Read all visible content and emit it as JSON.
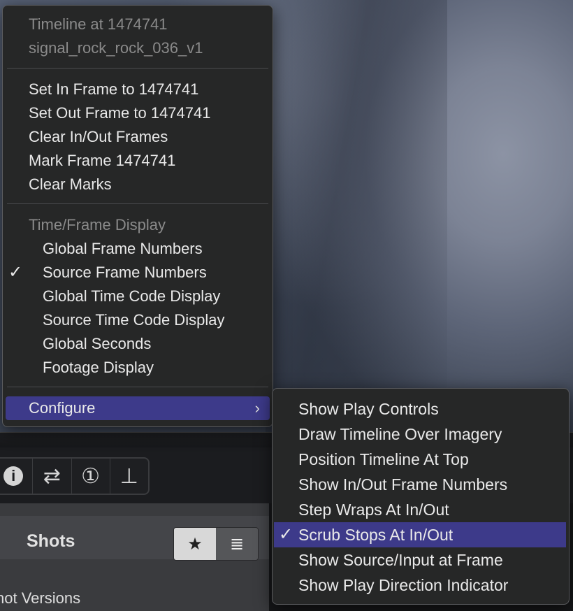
{
  "menu": {
    "header": {
      "line1": "Timeline at 1474741",
      "line2": "signal_rock_rock_036_v1"
    },
    "frame_items": [
      "Set In Frame to 1474741",
      "Set Out Frame to 1474741",
      "Clear In/Out Frames",
      "Mark Frame 1474741",
      "Clear Marks"
    ],
    "display_section": {
      "label": "Time/Frame Display",
      "items": [
        "Global Frame Numbers",
        "Source Frame Numbers",
        "Global Time Code Display",
        "Source Time Code Display",
        "Global Seconds",
        "Footage Display"
      ],
      "checked_index": 1,
      "check_mark": "✓"
    },
    "configure": {
      "label": "Configure",
      "arrow": "›"
    }
  },
  "submenu": {
    "items": [
      "Show Play Controls",
      "Draw Timeline Over Imagery",
      "Position Timeline At Top",
      "Show In/Out Frame Numbers",
      "Step Wraps At In/Out",
      "Scrub Stops At In/Out",
      "Show Source/Input at Frame",
      "Show Play Direction Indicator"
    ],
    "checked_index": 5,
    "check_mark": "✓"
  },
  "toolbar": {
    "icons": [
      "info-icon",
      "swap-arrows-icon",
      "in-frame-icon",
      "out-frame-icon"
    ],
    "glyphs": [
      "i",
      "⇄",
      "①",
      "⊥"
    ]
  },
  "shots_panel": {
    "title": "Shots",
    "star_glyph": "★",
    "list_glyph": "≣",
    "versions_label": "not Versions"
  },
  "colors": {
    "menu_bg": "#262727",
    "highlight": "#3d3a8a",
    "text": "#e9e9e9",
    "disabled_text": "#8a8a8a"
  }
}
